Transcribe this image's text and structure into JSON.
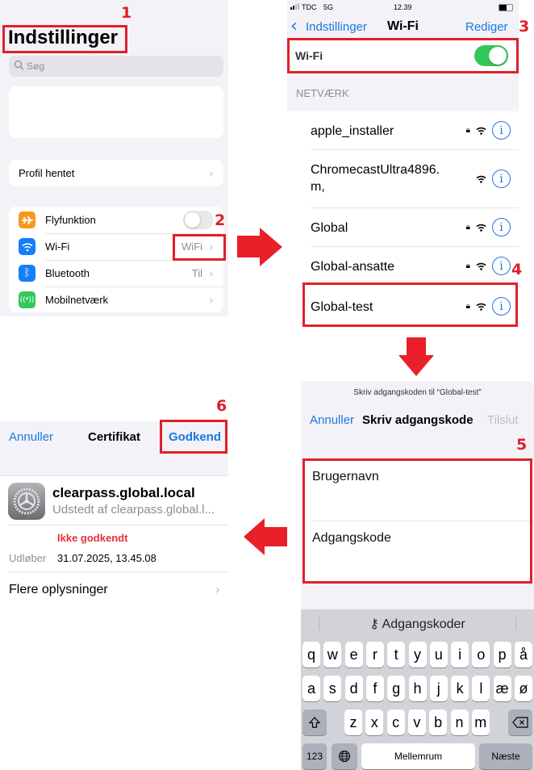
{
  "annotations": {
    "steps": [
      "1",
      "2",
      "3",
      "4",
      "5",
      "6"
    ],
    "accent_color": "#e0202a"
  },
  "settings": {
    "title": "Indstillinger",
    "search_placeholder": "Søg",
    "profile_label": "Profil hentet",
    "rows": [
      {
        "label": "Flyfunktion",
        "value": "",
        "icon": "airplane-icon",
        "color": "#f7981d",
        "toggle": false
      },
      {
        "label": "Wi-Fi",
        "value": "WiFi",
        "icon": "wifi-icon",
        "color": "#157efb"
      },
      {
        "label": "Bluetooth",
        "value": "Til",
        "icon": "bluetooth-icon",
        "color": "#157efb"
      },
      {
        "label": "Mobilnetværk",
        "value": "",
        "icon": "cellular-icon",
        "color": "#34c759"
      }
    ]
  },
  "wifi": {
    "status": {
      "carrier": "TDC",
      "network": "5G",
      "time": "12.39"
    },
    "back_label": "Indstillinger",
    "title": "Wi-Fi",
    "edit_label": "Rediger",
    "toggle_label": "Wi-Fi",
    "toggle_on": true,
    "section_header": "NETVÆRK",
    "networks": [
      {
        "name": "apple_installer",
        "locked": true
      },
      {
        "name": "ChromecastUltra4896.\nm,",
        "locked": false
      },
      {
        "name": "Global",
        "locked": true
      },
      {
        "name": "Global-ansatte",
        "locked": true
      },
      {
        "name": "Global-test",
        "locked": true
      }
    ]
  },
  "password": {
    "prompt": "Skriv adgangskoden til “Global-test”",
    "cancel_label": "Annuller",
    "title": "Skriv adgangskode",
    "join_label": "Tilslut",
    "username_placeholder": "Brugernavn",
    "password_placeholder": "Adgangskode",
    "keyboard": {
      "suggestion": "Adgangskoder",
      "row1": [
        "q",
        "w",
        "e",
        "r",
        "t",
        "y",
        "u",
        "i",
        "o",
        "p",
        "å"
      ],
      "row2": [
        "a",
        "s",
        "d",
        "f",
        "g",
        "h",
        "j",
        "k",
        "l",
        "æ",
        "ø"
      ],
      "row3": [
        "z",
        "x",
        "c",
        "v",
        "b",
        "n",
        "m"
      ],
      "numbers_label": "123",
      "space_label": "Mellemrum",
      "next_label": "Næste"
    }
  },
  "certificate": {
    "cancel_label": "Annuller",
    "title": "Certifikat",
    "accept_label": "Godkend",
    "name": "clearpass.global.local",
    "issuer": "Udstedt af clearpass.global.l...",
    "trust_status": "Ikke godkendt",
    "expires_label": "Udløber",
    "expires_value": "31.07.2025, 13.45.08",
    "more_label": "Flere oplysninger"
  }
}
